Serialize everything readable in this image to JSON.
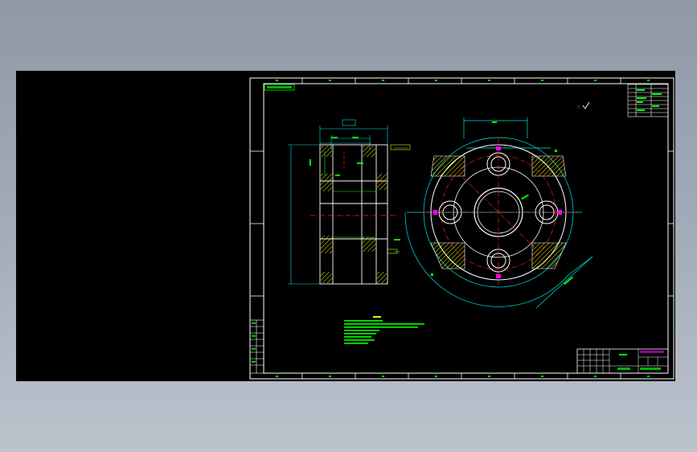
{
  "drawing": {
    "stamp_label": "",
    "view_side": {
      "dim_top": "",
      "dim_left": ""
    },
    "view_front": {
      "dim_bore": "",
      "dim_pcd": ""
    },
    "notes": {
      "title": "",
      "lines": [
        "",
        "",
        "",
        "",
        "",
        "",
        "",
        ""
      ]
    },
    "title_block": {
      "name": "",
      "drawing_no": "",
      "material": "",
      "scale": ""
    },
    "zone_numbers_top": [
      "",
      "",
      "",
      "",
      "",
      "",
      "",
      ""
    ],
    "zone_numbers_bottom": [
      "",
      "",
      "",
      "",
      "",
      "",
      "",
      ""
    ]
  },
  "colors": {
    "background": "#000000",
    "frame": "#ffffff",
    "cyan": "#00e5e5",
    "green": "#00ff00",
    "yellow": "#f0f000",
    "red": "#ff2020",
    "magenta": "#ff00ff"
  }
}
